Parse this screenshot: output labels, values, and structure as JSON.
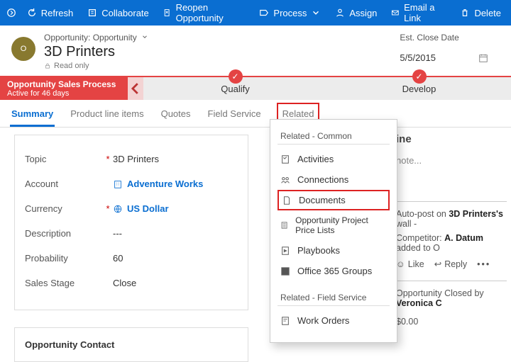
{
  "cmdbar": {
    "refresh": "Refresh",
    "collaborate": "Collaborate",
    "reopen": "Reopen Opportunity",
    "process": "Process",
    "assign": "Assign",
    "email": "Email a Link",
    "delete": "Delete"
  },
  "header": {
    "crumb": "Opportunity: Opportunity",
    "title": "3D Printers",
    "readonly": "Read only",
    "avatar": "O",
    "closeLabel": "Est. Close Date",
    "closeDate": "5/5/2015"
  },
  "process": {
    "name": "Opportunity Sales Process",
    "active": "Active for 46 days",
    "stages": [
      "Qualify",
      "Develop"
    ]
  },
  "tabs": {
    "summary": "Summary",
    "pli": "Product line items",
    "quotes": "Quotes",
    "fieldservice": "Field Service",
    "related": "Related"
  },
  "form": {
    "topic": {
      "label": "Topic",
      "value": "3D Printers"
    },
    "account": {
      "label": "Account",
      "value": "Adventure Works"
    },
    "currency": {
      "label": "Currency",
      "value": "US Dollar"
    },
    "description": {
      "label": "Description",
      "value": "---"
    },
    "probability": {
      "label": "Probability",
      "value": "60"
    },
    "salesStage": {
      "label": "Sales Stage",
      "value": "Close"
    },
    "contactTitle": "Opportunity Contact"
  },
  "relatedMenu": {
    "group1": "Related - Common",
    "activities": "Activities",
    "connections": "Connections",
    "documents": "Documents",
    "oppl": "Opportunity Project Price Lists",
    "playbooks": "Playbooks",
    "o365": "Office 365 Groups",
    "group2": "Related - Field Service",
    "workorders": "Work Orders"
  },
  "timeline": {
    "title": "ine",
    "notePlaceholder": " note...",
    "entry1a": "Auto-post on ",
    "entry1b": "3D Printers's",
    "entry1c": " wall - ",
    "entry2a": "Competitor: ",
    "entry2b": "A. Datum",
    "entry2c": " added to O",
    "like": "Like",
    "reply": "Reply",
    "entry3a": "Opportunity Closed by ",
    "entry3b": "Veronica C",
    "amount": "$0.00"
  }
}
